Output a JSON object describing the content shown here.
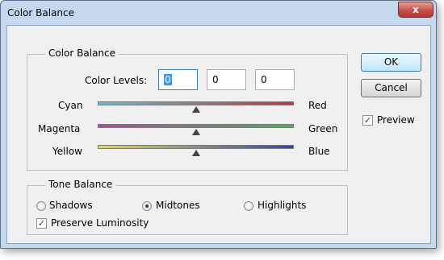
{
  "window": {
    "title": "Color Balance",
    "close_label": "x"
  },
  "color_balance": {
    "legend": "Color Balance",
    "levels_label": "Color Levels:",
    "levels": [
      "0",
      "0",
      "0"
    ],
    "sliders": [
      {
        "left": "Cyan",
        "right": "Red",
        "left_color": "#4fc7d6",
        "right_color": "#e0282e",
        "value": 0
      },
      {
        "left": "Magenta",
        "right": "Green",
        "left_color": "#c040b0",
        "right_color": "#3aba44",
        "value": 0
      },
      {
        "left": "Yellow",
        "right": "Blue",
        "left_color": "#e6e02a",
        "right_color": "#2e43c6",
        "value": 0
      }
    ]
  },
  "tone_balance": {
    "legend": "Tone Balance",
    "options": [
      "Shadows",
      "Midtones",
      "Highlights"
    ],
    "selected": "Midtones",
    "preserve_label": "Preserve Luminosity",
    "preserve_checked": true
  },
  "buttons": {
    "ok": "OK",
    "cancel": "Cancel"
  },
  "preview": {
    "label": "Preview",
    "checked": true
  }
}
